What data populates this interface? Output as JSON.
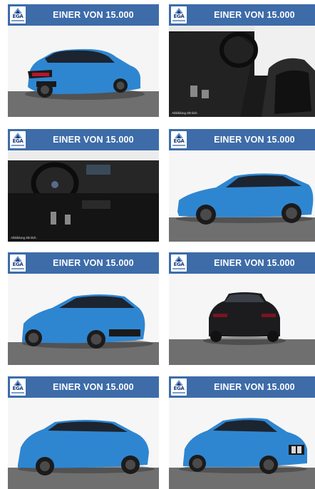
{
  "tiles": [
    {
      "banner_title": "EINER VON 15.000",
      "logo_text": "EGA",
      "view": "rear-three-quarter-blue",
      "note": ""
    },
    {
      "banner_title": "EINER VON 15.000",
      "logo_text": "EGA",
      "view": "interior-front-seats",
      "note": "Abbildung ähnlich."
    },
    {
      "banner_title": "EINER VON 15.000",
      "logo_text": "EGA",
      "view": "interior-dashboard",
      "note": "Abbildung ähnlich."
    },
    {
      "banner_title": "EINER VON 15.000",
      "logo_text": "EGA",
      "view": "side-profile-blue",
      "note": ""
    },
    {
      "banner_title": "EINER VON 15.000",
      "logo_text": "EGA",
      "view": "front-three-quarter-left-blue",
      "note": ""
    },
    {
      "banner_title": "EINER VON 15.000",
      "logo_text": "EGA",
      "view": "rear-black",
      "note": ""
    },
    {
      "banner_title": "EINER VON 15.000",
      "logo_text": "EGA",
      "view": "rear-side-blue",
      "note": ""
    },
    {
      "banner_title": "EINER VON 15.000",
      "logo_text": "EGA",
      "view": "front-three-quarter-right-blue",
      "note": ""
    }
  ],
  "colors": {
    "banner": "#3d6ca9",
    "car_blue": "#2e86d1",
    "car_black": "#1c1c1e",
    "floor": "#6e6e6e"
  }
}
